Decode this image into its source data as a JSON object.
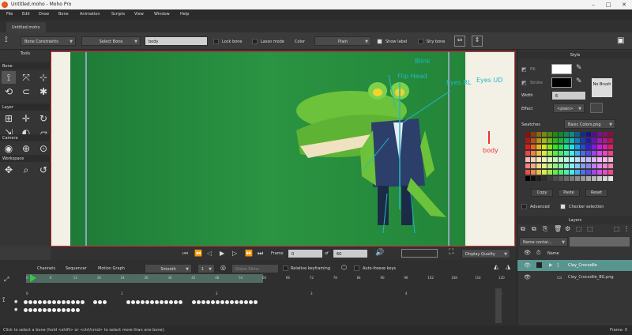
{
  "window": {
    "title": "Untitled.moho - Moho Pro",
    "min": "–",
    "max": "□",
    "close": "✕"
  },
  "menu": [
    "File",
    "Edit",
    "Draw",
    "Bone",
    "Animation",
    "Scripts",
    "View",
    "Window",
    "Help"
  ],
  "doc_tab": "Untitled.moho",
  "tool_options": {
    "bone_constraints": "Bone Constraints",
    "select_bone": "Select Bone",
    "bone_name": "body",
    "lock_bone": "Lock bone",
    "lasso_mode": "Lasso mode",
    "color_label": "Color",
    "color_value": "Plain",
    "show_label": "Show label",
    "shy_bone": "Shy bone"
  },
  "left_panel": {
    "title": "Tools",
    "sections": [
      "Bone",
      "Layer",
      "Camera",
      "Workspace"
    ]
  },
  "bones": {
    "blink": "Blink",
    "flip_head": "Flip Head",
    "eyes_rl": "Eyes RL",
    "eyes_ud": "Eyes UD",
    "body": "body"
  },
  "transport": {
    "frame_label": "Frame",
    "frame_value": "0",
    "of_label": "of",
    "end_value": "60",
    "display_quality": "Display Quality"
  },
  "timeline": {
    "tabs": [
      "Channels",
      "Sequencer",
      "Motion Graph"
    ],
    "interp": "Smooth",
    "interp_num": "1",
    "onion": "Onion Skins",
    "relative_kf": "Relative keyframing",
    "auto_freeze": "Auto-freeze keys",
    "ruler": [
      "0",
      "6",
      "12",
      "18",
      "24",
      "30",
      "36",
      "42",
      "48",
      "54",
      "60",
      "66",
      "72",
      "78",
      "84",
      "90",
      "96",
      "102",
      "108",
      "114",
      "120"
    ],
    "ruler2": [
      "0",
      "1",
      "2",
      "3",
      "4",
      "5"
    ]
  },
  "style": {
    "title": "Style",
    "fill": "Fill",
    "stroke": "Stroke",
    "width_label": "Width",
    "width_value": "6",
    "no_brush": "No Brush",
    "effect": "Effect",
    "effect_value": "<plain>",
    "swatches_label": "Swatches",
    "swatches_value": "Basic Colors.png",
    "copy": "Copy",
    "paste": "Paste",
    "reset": "Reset",
    "advanced": "Advanced",
    "checker": "Checker selection"
  },
  "layers": {
    "title": "Layers",
    "filter": "Name contai...",
    "col_name": "Name",
    "items": [
      {
        "name": "Clay_Crocodile",
        "selected": true
      },
      {
        "name": "Clay_Crocodile_BG.png",
        "selected": false
      }
    ]
  },
  "status": {
    "hint": "Click to select a bone (hold <shift> or <ctrl/cmd> to select more than one bone).",
    "frame": "Frame: 0"
  }
}
